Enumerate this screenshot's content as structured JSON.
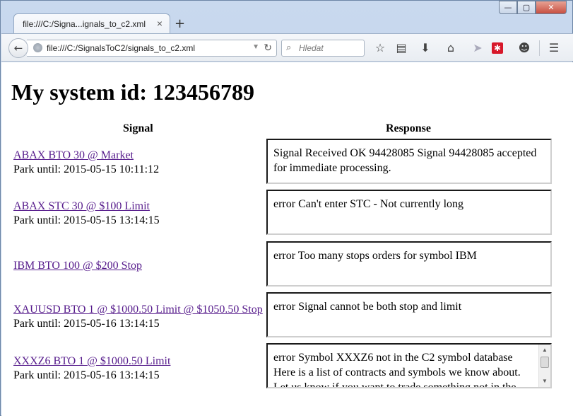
{
  "window": {
    "tab_title": "file:///C:/Signa...ignals_to_c2.xml",
    "tab_close": "×",
    "new_tab": "+",
    "minimize": "—",
    "maximize": "▢",
    "close": "✕"
  },
  "toolbar": {
    "back": "←",
    "url": "file:///C:/SignalsToC2/signals_to_c2.xml",
    "search_placeholder": "Hledat",
    "icons": [
      "star-icon",
      "reading-list-icon",
      "download-icon",
      "home-icon",
      "send-icon",
      "addon-icon",
      "smiley-icon",
      "menu-icon"
    ]
  },
  "page": {
    "title": "My system id: 123456789",
    "col_signal": "Signal",
    "col_response": "Response",
    "rows": [
      {
        "signal": "ABAX BTO 30 @ Market",
        "park": "Park until: 2015-05-15 10:11:12",
        "response": "Signal Received OK 94428085 Signal 94428085 accepted for immediate processing."
      },
      {
        "signal": "ABAX STC 30 @ $100 Limit",
        "park": "Park until: 2015-05-15 13:14:15",
        "response": "error Can't enter STC - Not currently long"
      },
      {
        "signal": "IBM BTO 100 @ $200 Stop",
        "park": "",
        "response": "error Too many stops orders for symbol IBM"
      },
      {
        "signal": "XAUUSD BTO 1 @ $1000.50 Limit @ $1050.50 Stop",
        "park": "Park until: 2015-05-16 13:14:15",
        "response": "error Signal cannot be both stop and limit"
      },
      {
        "signal": "XXXZ6 BTO 1 @ $1000.50 Limit",
        "park": "Park until: 2015-05-16 13:14:15",
        "response": "error Symbol XXXZ6 not in the C2 symbol database Here is a list of contracts and symbols we know about. Let us know if you want to trade something not in the"
      }
    ]
  },
  "colors": {
    "link": "#551a8b",
    "close_button": "#c75042",
    "addon_icon": "#d7182a"
  }
}
